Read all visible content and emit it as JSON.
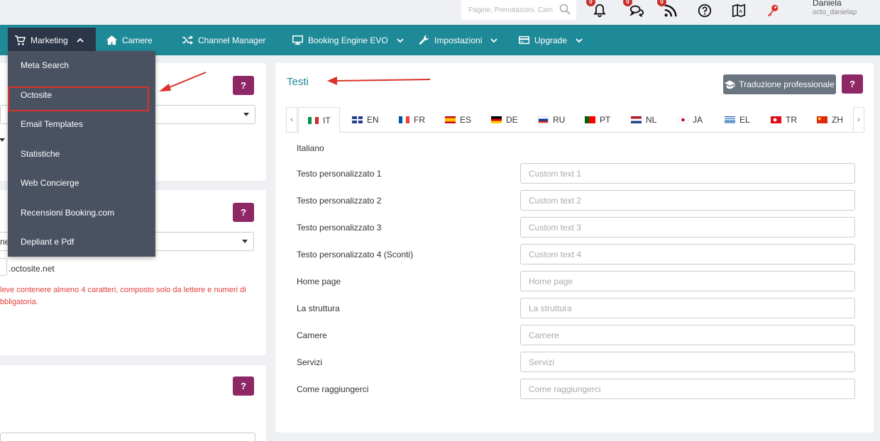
{
  "search": {
    "placeholder": "Pagine, Prenotazioni, Cam"
  },
  "topbar": {
    "icons": [
      "bell-icon",
      "chat-icon",
      "rss-icon",
      "help-icon",
      "book-icon",
      "key-icon"
    ],
    "badges": [
      "0",
      "0",
      "0"
    ],
    "user_name": "Daniela",
    "user_login": "octo_danielap"
  },
  "nav": {
    "items": [
      {
        "label": "Marketing",
        "icon": "cart-icon"
      },
      {
        "label": "Camere",
        "icon": "home-icon"
      },
      {
        "label": "Channel Manager",
        "icon": "shuffle-icon"
      },
      {
        "label": "Booking Engine EVO",
        "icon": "monitor-icon"
      },
      {
        "label": "Impostazioni",
        "icon": "wrench-icon"
      },
      {
        "label": "Upgrade",
        "icon": "card-icon"
      }
    ]
  },
  "dropdown": {
    "items": [
      "Meta Search",
      "Octosite",
      "Email Templates",
      "Statistiche",
      "Web Concierge",
      "Recensioni Booking.com",
      "Depliant e Pdf"
    ]
  },
  "left": {
    "help": "?",
    "select2_text": "ne",
    "domain_suffix": ".octosite.net",
    "error_line1": "leve contenere almeno 4 caratteri, composto solo da lettere e numeri di",
    "error_line2": "bbligatoria."
  },
  "main": {
    "title": "Testi",
    "translate_button": "Traduzione professionale",
    "help": "?",
    "tab_prev": "‹",
    "tab_next": "›",
    "tabs": [
      "IT",
      "EN",
      "FR",
      "ES",
      "DE",
      "RU",
      "PT",
      "NL",
      "JA",
      "EL",
      "TR",
      "ZH"
    ],
    "language": "Italiano",
    "fields": [
      {
        "label": "Testo personalizzato 1",
        "placeholder": "Custom text 1"
      },
      {
        "label": "Testo personalizzato 2",
        "placeholder": "Custom text 2"
      },
      {
        "label": "Testo personalizzato 3",
        "placeholder": "Custom text 3"
      },
      {
        "label": "Testo personalizzato 4 (Sconti)",
        "placeholder": "Custom text 4"
      },
      {
        "label": "Home page",
        "placeholder": "Home page"
      },
      {
        "label": "La struttura",
        "placeholder": "La struttura"
      },
      {
        "label": "Camere",
        "placeholder": "Camere"
      },
      {
        "label": "Servizi",
        "placeholder": "Servizi"
      },
      {
        "label": "Come raggiungerci",
        "placeholder": "Come raggiungerci"
      }
    ]
  },
  "colors": {
    "nav": "#1f8a97",
    "active_nav": "#2b3648",
    "dropdown": "#4a5262",
    "help_button": "#8e2766",
    "highlight": "#d9322a"
  }
}
